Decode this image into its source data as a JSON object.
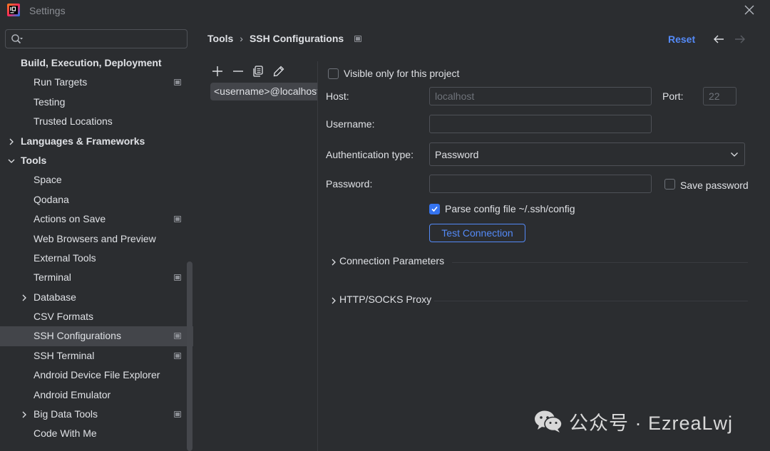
{
  "window": {
    "title": "Settings",
    "app_icon": "intellij-logo-icon",
    "close_icon": "close-icon"
  },
  "search": {
    "placeholder": "",
    "value": ""
  },
  "sidebar": {
    "items": [
      {
        "label": "Build, Execution, Deployment",
        "level": 0,
        "bold": true,
        "chevron": "none",
        "badge": false
      },
      {
        "label": "Run Targets",
        "level": 1,
        "bold": false,
        "chevron": "none",
        "badge": true
      },
      {
        "label": "Testing",
        "level": 1,
        "bold": false,
        "chevron": "none",
        "badge": false
      },
      {
        "label": "Trusted Locations",
        "level": 1,
        "bold": false,
        "chevron": "none",
        "badge": false
      },
      {
        "label": "Languages & Frameworks",
        "level": 0,
        "bold": true,
        "chevron": "right",
        "badge": false
      },
      {
        "label": "Tools",
        "level": 0,
        "bold": true,
        "chevron": "down",
        "badge": false
      },
      {
        "label": "Space",
        "level": 1,
        "bold": false,
        "chevron": "none",
        "badge": false
      },
      {
        "label": "Qodana",
        "level": 1,
        "bold": false,
        "chevron": "none",
        "badge": false
      },
      {
        "label": "Actions on Save",
        "level": 1,
        "bold": false,
        "chevron": "none",
        "badge": true
      },
      {
        "label": "Web Browsers and Preview",
        "level": 1,
        "bold": false,
        "chevron": "none",
        "badge": false
      },
      {
        "label": "External Tools",
        "level": 1,
        "bold": false,
        "chevron": "none",
        "badge": false
      },
      {
        "label": "Terminal",
        "level": 1,
        "bold": false,
        "chevron": "none",
        "badge": true
      },
      {
        "label": "Database",
        "level": 1,
        "bold": false,
        "chevron": "right",
        "badge": false
      },
      {
        "label": "CSV Formats",
        "level": 1,
        "bold": false,
        "chevron": "none",
        "badge": false
      },
      {
        "label": "SSH Configurations",
        "level": 1,
        "bold": false,
        "chevron": "none",
        "badge": true,
        "selected": true
      },
      {
        "label": "SSH Terminal",
        "level": 1,
        "bold": false,
        "chevron": "none",
        "badge": true
      },
      {
        "label": "Android Device File Explorer",
        "level": 1,
        "bold": false,
        "chevron": "none",
        "badge": false
      },
      {
        "label": "Android Emulator",
        "level": 1,
        "bold": false,
        "chevron": "none",
        "badge": false
      },
      {
        "label": "Big Data Tools",
        "level": 1,
        "bold": false,
        "chevron": "right",
        "badge": true
      },
      {
        "label": "Code With Me",
        "level": 1,
        "bold": false,
        "chevron": "none",
        "badge": false
      }
    ]
  },
  "header": {
    "breadcrumb_parent": "Tools",
    "breadcrumb_sep": "›",
    "breadcrumb_current": "SSH Configurations",
    "reset_label": "Reset"
  },
  "list": {
    "entries": [
      "<username>@localhost"
    ]
  },
  "form": {
    "visible_only_label": "Visible only for this project",
    "visible_only_checked": false,
    "host_label": "Host:",
    "host_value": "localhost",
    "port_label": "Port:",
    "port_value": "22",
    "username_label": "Username:",
    "username_value": "",
    "auth_type_label": "Authentication type:",
    "auth_type_value": "Password",
    "password_label": "Password:",
    "password_value": "",
    "save_password_label": "Save password",
    "save_password_checked": false,
    "parse_config_label": "Parse config file ~/.ssh/config",
    "parse_config_checked": true,
    "test_connection_label": "Test Connection",
    "connection_params_label": "Connection Parameters",
    "proxy_label": "HTTP/SOCKS Proxy"
  },
  "watermark": {
    "text": "公众号 · EzreaLwj",
    "icon": "wechat-icon"
  },
  "colors": {
    "background": "#2b2d30",
    "selection": "#43454a",
    "accent": "#548af7",
    "checkbox_checked": "#3574f0",
    "text": "#dfe1e5",
    "muted": "#8b8e94"
  }
}
